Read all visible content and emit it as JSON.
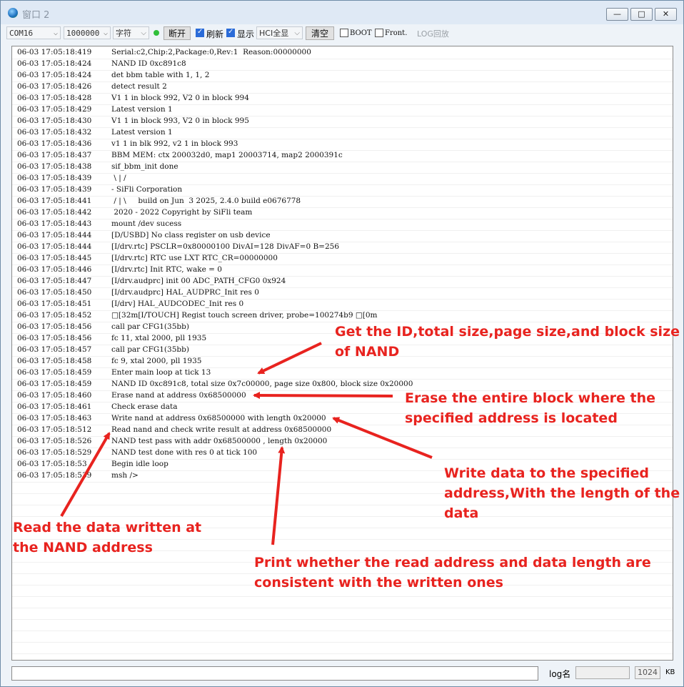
{
  "window": {
    "title": "窗口 2",
    "controls": {
      "minimize": "—",
      "maximize": "□",
      "close": "✕"
    }
  },
  "toolbar": {
    "port": "COM16",
    "baud": "1000000",
    "encoding": "字符",
    "connect_label": "断开",
    "refresh": {
      "label": "刷新",
      "checked": true
    },
    "display": {
      "label": "显示",
      "checked": true
    },
    "hci_select": "HCI全显",
    "clear_label": "清空",
    "boot": {
      "label": "BOOT",
      "checked": false
    },
    "front": {
      "label": "Front.",
      "checked": false
    },
    "log_replay_label": "LOG回放"
  },
  "log": [
    {
      "ts": "06-03 17:05:18:419",
      "msg": "Serial:c2,Chip:2,Package:0,Rev:1  Reason:00000000"
    },
    {
      "ts": "06-03 17:05:18:424",
      "msg": "NAND ID 0xc891c8"
    },
    {
      "ts": "06-03 17:05:18:424",
      "msg": "det bbm table with 1, 1, 2"
    },
    {
      "ts": "06-03 17:05:18:426",
      "msg": "detect result 2"
    },
    {
      "ts": "06-03 17:05:18:428",
      "msg": "V1 1 in block 992, V2 0 in block 994"
    },
    {
      "ts": "06-03 17:05:18:429",
      "msg": "Latest version 1"
    },
    {
      "ts": "06-03 17:05:18:430",
      "msg": "V1 1 in block 993, V2 0 in block 995"
    },
    {
      "ts": "06-03 17:05:18:432",
      "msg": "Latest version 1"
    },
    {
      "ts": "06-03 17:05:18:436",
      "msg": "v1 1 in blk 992, v2 1 in block 993"
    },
    {
      "ts": "06-03 17:05:18:437",
      "msg": "BBM MEM: ctx 200032d0, map1 20003714, map2 2000391c"
    },
    {
      "ts": "06-03 17:05:18:438",
      "msg": "sif_bbm_init done"
    },
    {
      "ts": "06-03 17:05:18:439",
      "msg": " \\ | /"
    },
    {
      "ts": "06-03 17:05:18:439",
      "msg": "- SiFli Corporation"
    },
    {
      "ts": "06-03 17:05:18:441",
      "msg": " / | \\     build on Jun  3 2025, 2.4.0 build e0676778"
    },
    {
      "ts": "06-03 17:05:18:442",
      "msg": " 2020 - 2022 Copyright by SiFli team"
    },
    {
      "ts": "06-03 17:05:18:443",
      "msg": "mount /dev sucess"
    },
    {
      "ts": "06-03 17:05:18:444",
      "msg": "[D/USBD] No class register on usb device"
    },
    {
      "ts": "06-03 17:05:18:444",
      "msg": "[I/drv.rtc] PSCLR=0x80000100 DivAI=128 DivAF=0 B=256"
    },
    {
      "ts": "06-03 17:05:18:445",
      "msg": "[I/drv.rtc] RTC use LXT RTC_CR=00000000"
    },
    {
      "ts": "06-03 17:05:18:446",
      "msg": "[I/drv.rtc] Init RTC, wake = 0"
    },
    {
      "ts": "06-03 17:05:18:447",
      "msg": "[I/drv.audprc] init 00 ADC_PATH_CFG0 0x924"
    },
    {
      "ts": "06-03 17:05:18:450",
      "msg": "[I/drv.audprc] HAL_AUDPRC_Init res 0"
    },
    {
      "ts": "06-03 17:05:18:451",
      "msg": "[I/drv] HAL_AUDCODEC_Init res 0"
    },
    {
      "ts": "06-03 17:05:18:452",
      "msg": "□[32m[I/TOUCH] Regist touch screen driver, probe=100274b9 □[0m"
    },
    {
      "ts": "06-03 17:05:18:456",
      "msg": "call par CFG1(35bb)"
    },
    {
      "ts": "06-03 17:05:18:456",
      "msg": "fc 11, xtal 2000, pll 1935"
    },
    {
      "ts": "06-03 17:05:18:457",
      "msg": "call par CFG1(35bb)"
    },
    {
      "ts": "06-03 17:05:18:458",
      "msg": "fc 9, xtal 2000, pll 1935"
    },
    {
      "ts": "06-03 17:05:18:459",
      "msg": "Enter main loop at tick 13"
    },
    {
      "ts": "06-03 17:05:18:459",
      "msg": "NAND ID 0xc891c8, total size 0x7c00000, page size 0x800, block size 0x20000"
    },
    {
      "ts": "06-03 17:05:18:460",
      "msg": "Erase nand at address 0x68500000"
    },
    {
      "ts": "06-03 17:05:18:461",
      "msg": "Check erase data"
    },
    {
      "ts": "06-03 17:05:18:463",
      "msg": "Write nand at address 0x68500000 with length 0x20000"
    },
    {
      "ts": "06-03 17:05:18:512",
      "msg": "Read nand and check write result at address 0x68500000"
    },
    {
      "ts": "06-03 17:05:18:526",
      "msg": "NAND test pass with addr 0x68500000 , length 0x20000"
    },
    {
      "ts": "06-03 17:05:18:529",
      "msg": "NAND test done with res 0 at tick 100"
    },
    {
      "ts": "06-03 17:05:18:53",
      "msg": "Begin idle loop"
    },
    {
      "ts": "06-03 17:05:18:539",
      "msg": "msh />"
    }
  ],
  "annotations": {
    "get_id": "Get the ID,total size,page size,and block size\nof NAND",
    "erase": "Erase the entire block where the\nspecified address is located",
    "write": "Write data to the specified\naddress,With the length of the\ndata",
    "read": "Read the data written at\nthe NAND address",
    "print": "Print whether the read address and data length are\nconsistent with the written ones",
    "color": "#e8231f"
  },
  "statusbar": {
    "input_value": "",
    "logname_label": "log名",
    "logname_value": "",
    "size_value": "1024",
    "unit": "KB"
  }
}
